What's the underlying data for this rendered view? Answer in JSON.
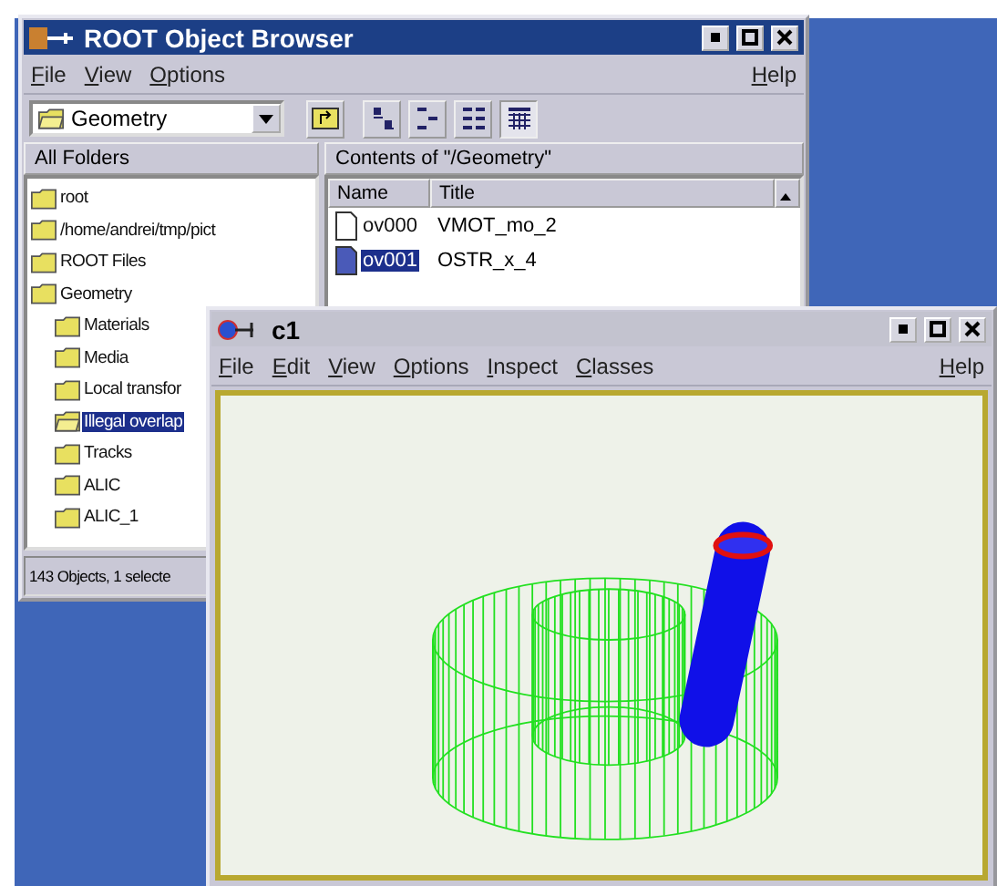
{
  "browser": {
    "title": "ROOT Object Browser",
    "menu": [
      {
        "label": "File"
      },
      {
        "label": "View"
      },
      {
        "label": "Options"
      }
    ],
    "help": "Help",
    "combo": {
      "value": "Geometry"
    },
    "view_buttons": [
      {
        "kind": "large",
        "selected": false
      },
      {
        "kind": "small",
        "selected": false
      },
      {
        "kind": "list",
        "selected": false
      },
      {
        "kind": "details",
        "selected": true
      }
    ],
    "folders_header": "All Folders",
    "contents_header": "Contents of \"/Geometry\"",
    "tree": [
      {
        "label": "root",
        "selected": false
      },
      {
        "label": "/home/andrei/tmp/pict",
        "selected": false
      },
      {
        "label": "ROOT Files",
        "selected": false
      },
      {
        "label": "Geometry",
        "selected": false,
        "children": [
          {
            "label": "Materials",
            "selected": false
          },
          {
            "label": "Media",
            "selected": false
          },
          {
            "label": "Local transfor",
            "selected": false
          },
          {
            "label": "Illegal overlap",
            "selected": true
          },
          {
            "label": "Tracks",
            "selected": false
          },
          {
            "label": "ALIC",
            "selected": false
          },
          {
            "label": "ALIC_1",
            "selected": false
          }
        ]
      }
    ],
    "columns": [
      "Name",
      "Title"
    ],
    "rows": [
      {
        "name": "ov000",
        "title": "VMOT_mo_2",
        "selected": false
      },
      {
        "name": "ov001",
        "title": "OSTR_x_4",
        "selected": true
      }
    ],
    "status": "143 Objects, 1 selecte"
  },
  "canvas": {
    "title": "c1",
    "menu": [
      {
        "label": "File"
      },
      {
        "label": "Edit"
      },
      {
        "label": "View"
      },
      {
        "label": "Options"
      },
      {
        "label": "Inspect"
      },
      {
        "label": "Classes"
      }
    ],
    "help": "Help"
  }
}
